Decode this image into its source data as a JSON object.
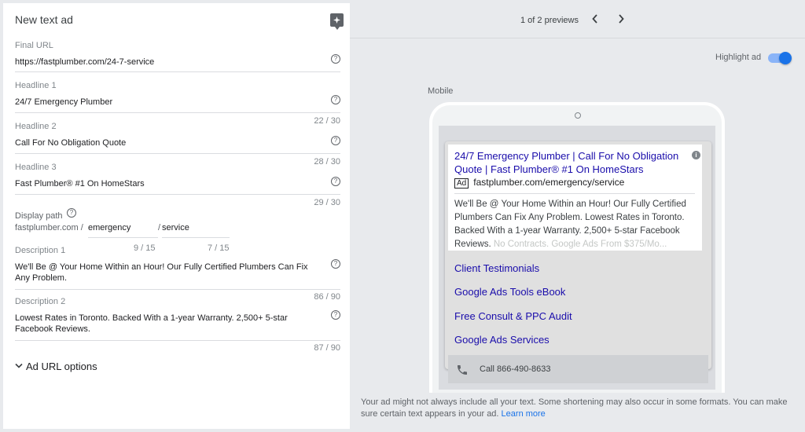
{
  "editor": {
    "title": "New text ad",
    "final_url": {
      "label": "Final URL",
      "value": "https://fastplumber.com/24-7-service"
    },
    "headline1": {
      "label": "Headline 1",
      "value": "24/7 Emergency Plumber",
      "count": "22 / 30"
    },
    "headline2": {
      "label": "Headline 2",
      "value": "Call For No Obligation Quote",
      "count": "28 / 30"
    },
    "headline3": {
      "label": "Headline 3",
      "value": "Fast Plumber® #1 On HomeStars",
      "count": "29 / 30"
    },
    "display_path": {
      "label": "Display path",
      "domain": "fastplumber.com /",
      "path1": "emergency",
      "separator": "/",
      "path2": "service",
      "path1_count": "9 / 15",
      "path2_count": "7 / 15"
    },
    "description1": {
      "label": "Description 1",
      "value": "We'll Be @ Your Home Within an Hour! Our Fully Certified Plumbers Can Fix Any Problem.",
      "count": "86 / 90"
    },
    "description2": {
      "label": "Description 2",
      "value": "Lowest Rates in Toronto. Backed With a 1-year Warranty. 2,500+ 5-star Facebook Reviews.",
      "count": "87 / 90"
    },
    "ad_url_options": "Ad URL options"
  },
  "preview": {
    "pager": "1 of 2 previews",
    "highlight_label": "Highlight ad",
    "highlight_on": true,
    "device_label": "Mobile",
    "ad": {
      "headline": "24/7 Emergency Plumber | Call For No Obligation Quote | Fast Plumber® #1 On HomeStars",
      "badge": "Ad",
      "url": "fastplumber.com/emergency/service",
      "description": "We'll Be @ Your Home Within an Hour! Our Fully Certified Plumbers Can Fix Any Problem. Lowest Rates in Toronto. Backed With a 1-year Warranty. 2,500+ 5-star Facebook Reviews.",
      "description_faded": "No Contracts. Google Ads From $375/Mo...",
      "sitelinks": [
        "Client Testimonials",
        "Google Ads Tools eBook",
        "Free Consult & PPC Audit",
        "Google Ads Services"
      ],
      "call": "Call 866-490-8633"
    },
    "footnote": "Your ad might not always include all your text. Some shortening may also occur in some formats. You can make sure certain text appears in your ad.",
    "learn_more": "Learn more"
  },
  "colors": {
    "link": "#1a0dab",
    "accent": "#1a73e8"
  }
}
